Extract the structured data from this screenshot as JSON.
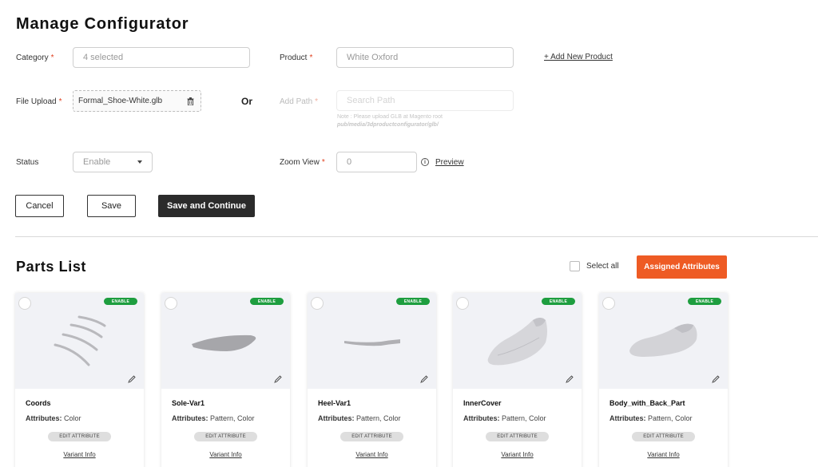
{
  "page": {
    "title": "Manage Configurator"
  },
  "form": {
    "category": {
      "label": "Category",
      "value": "4 selected"
    },
    "product": {
      "label": "Product",
      "value": "White Oxford",
      "add_link": "+ Add New Product"
    },
    "file_upload": {
      "label": "File Upload",
      "file_name": "Formal_Shoe-White.glb"
    },
    "or_label": "Or",
    "add_path": {
      "label": "Add Path",
      "placeholder": "Search Path",
      "note": "Note : Please upload GLB at Magento root",
      "note_path": "pub/media/3dproductconfigurator/glb/"
    },
    "status": {
      "label": "Status",
      "value": "Enable"
    },
    "zoom_view": {
      "label": "Zoom View",
      "value": "0",
      "preview_link": "Preview"
    },
    "required_mark": "*"
  },
  "actions": {
    "cancel": "Cancel",
    "save": "Save",
    "save_continue": "Save and Continue"
  },
  "parts": {
    "title": "Parts List",
    "select_all": "Select all",
    "assigned_attributes": "Assigned Attributes",
    "attributes_label": "Attributes:",
    "edit_attribute_label": "EDIT ATTRIBUTE",
    "variant_info_label": "Variant Info",
    "items": [
      {
        "name": "Coords",
        "status": "ENABLE",
        "attributes": "Color",
        "image": "coords-lines-image"
      },
      {
        "name": "Sole-Var1",
        "status": "ENABLE",
        "attributes": "Pattern, Color",
        "image": "sole-image"
      },
      {
        "name": "Heel-Var1",
        "status": "ENABLE",
        "attributes": "Pattern, Color",
        "image": "heel-image"
      },
      {
        "name": "InnerCover",
        "status": "ENABLE",
        "attributes": "Pattern, Color",
        "image": "shoe-inner-image"
      },
      {
        "name": "Body_with_Back_Part",
        "status": "ENABLE",
        "attributes": "Pattern, Color",
        "image": "shoe-body-image"
      }
    ]
  },
  "colors": {
    "accent": "#ee5b24",
    "enable_badge": "#1e9e3f",
    "dark_button": "#2b2b2b",
    "required": "#e0401f"
  }
}
